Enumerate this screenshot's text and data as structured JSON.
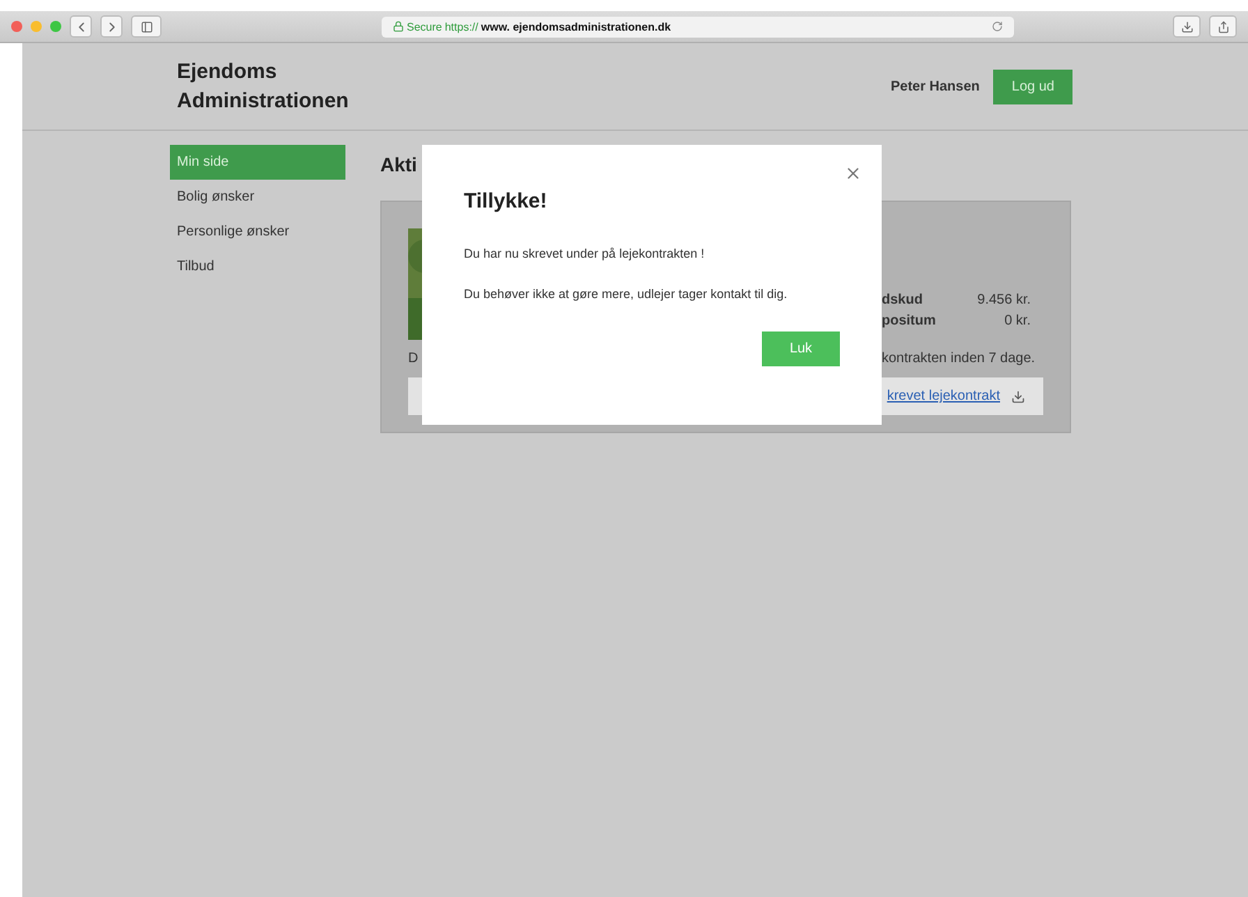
{
  "browser": {
    "secure_label": "Secure",
    "url_scheme": "https://",
    "url_host": "www. ejendomsadministrationen.dk"
  },
  "header": {
    "logo": "Ejendoms Administrationen",
    "user": "Peter Hansen",
    "logout": "Log ud"
  },
  "sidebar": {
    "items": [
      {
        "label": "Min side",
        "selected": true
      },
      {
        "label": "Bolig ønsker",
        "selected": false
      },
      {
        "label": "Personlige ønsker",
        "selected": false
      },
      {
        "label": "Tilbud",
        "selected": false
      }
    ]
  },
  "main": {
    "heading": "Akti",
    "card": {
      "text": "D",
      "facts": [
        {
          "label": "dskud",
          "value": "9.456 kr."
        },
        {
          "label": "positum",
          "value": "0 kr."
        }
      ],
      "note": "kontrakten inden 7 dage.",
      "download_link": "krevet lejekontrakt"
    }
  },
  "modal": {
    "title": "Tillykke!",
    "paragraphs": [
      "Du har nu skrevet under på lejekontrakten !",
      "Du behøver ikke at gøre mere, udlejer tager kontakt til dig."
    ],
    "button": "Luk"
  }
}
